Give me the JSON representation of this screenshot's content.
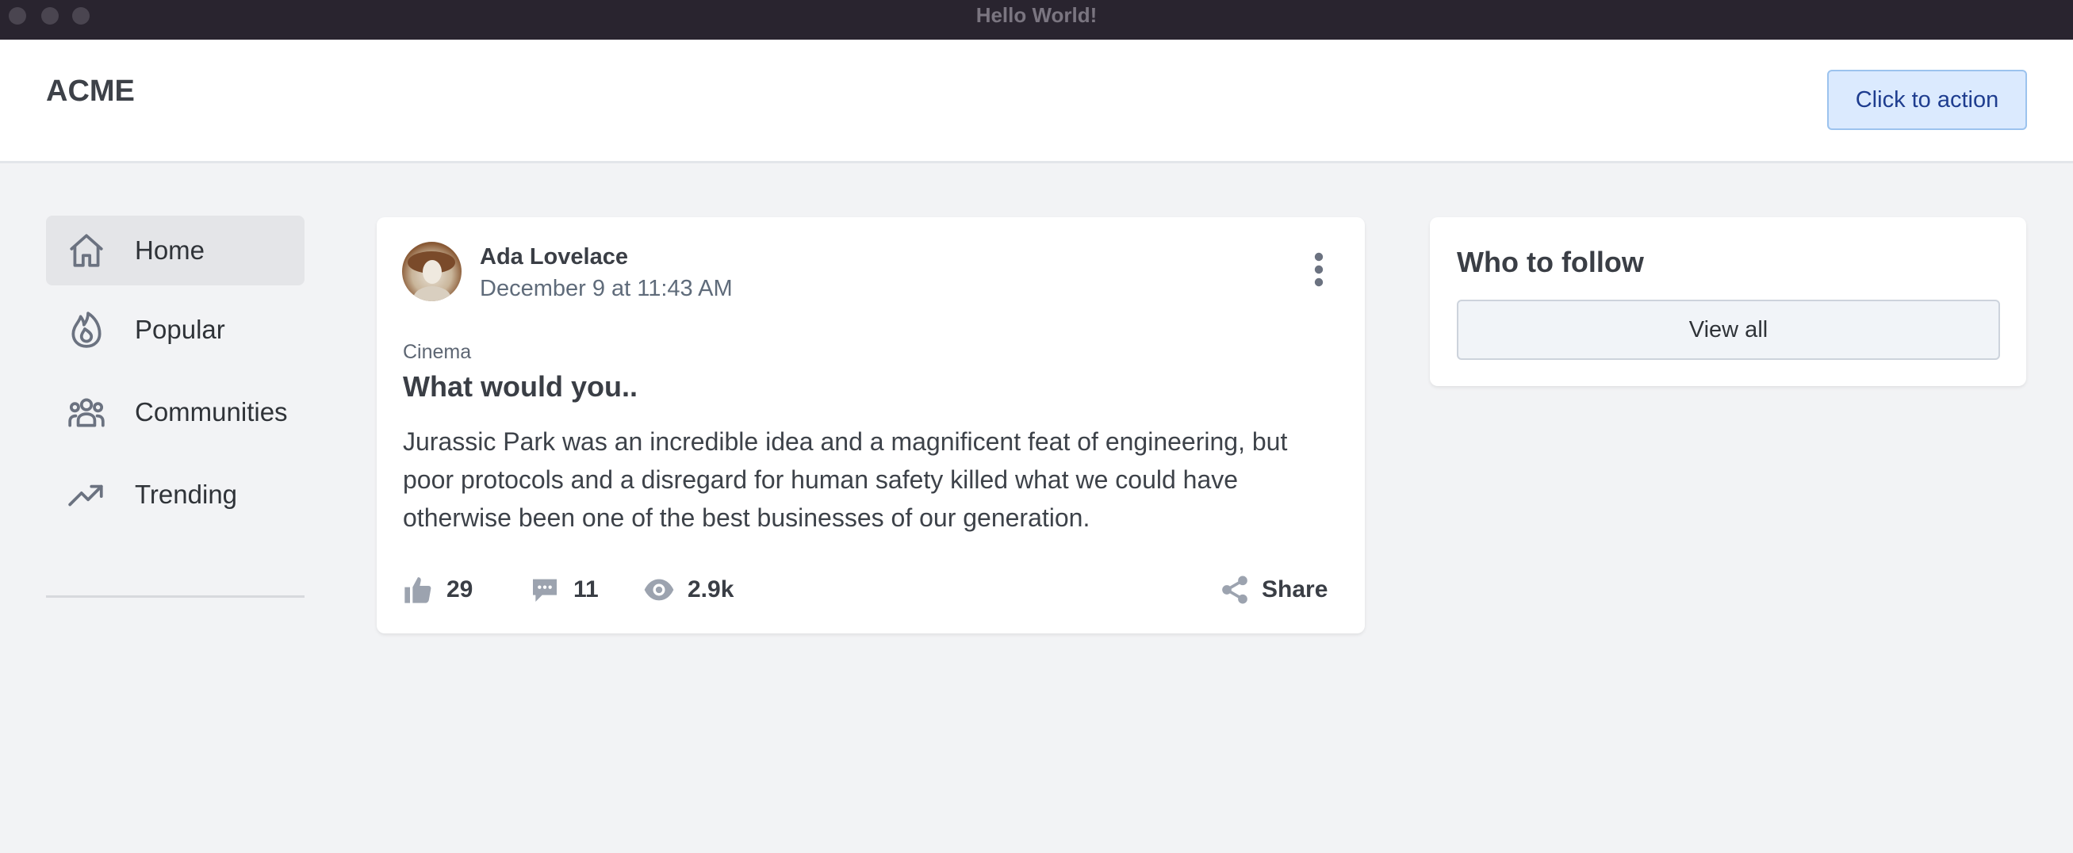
{
  "window": {
    "title": "Hello World!"
  },
  "header": {
    "brand": "ACME",
    "cta_label": "Click to action"
  },
  "sidebar": {
    "items": [
      {
        "label": "Home",
        "icon": "home-icon",
        "active": true
      },
      {
        "label": "Popular",
        "icon": "flame-icon",
        "active": false
      },
      {
        "label": "Communities",
        "icon": "users-icon",
        "active": false
      },
      {
        "label": "Trending",
        "icon": "trending-icon",
        "active": false
      }
    ]
  },
  "post": {
    "author": "Ada Lovelace",
    "date": "December 9 at 11:43 AM",
    "category": "Cinema",
    "title": "What would you..",
    "body": "Jurassic Park was an incredible idea and a magnificent feat of engineering, but poor protocols and a disregard for human safety killed what we could have otherwise been one of the best businesses of our generation.",
    "likes": "29",
    "comments": "11",
    "views": "2.9k",
    "share_label": "Share"
  },
  "follow": {
    "title": "Who to follow",
    "view_all_label": "View all"
  },
  "colors": {
    "accent_bg": "#dbeafe",
    "accent_text": "#1e3d8f",
    "icon": "#6b7280"
  }
}
